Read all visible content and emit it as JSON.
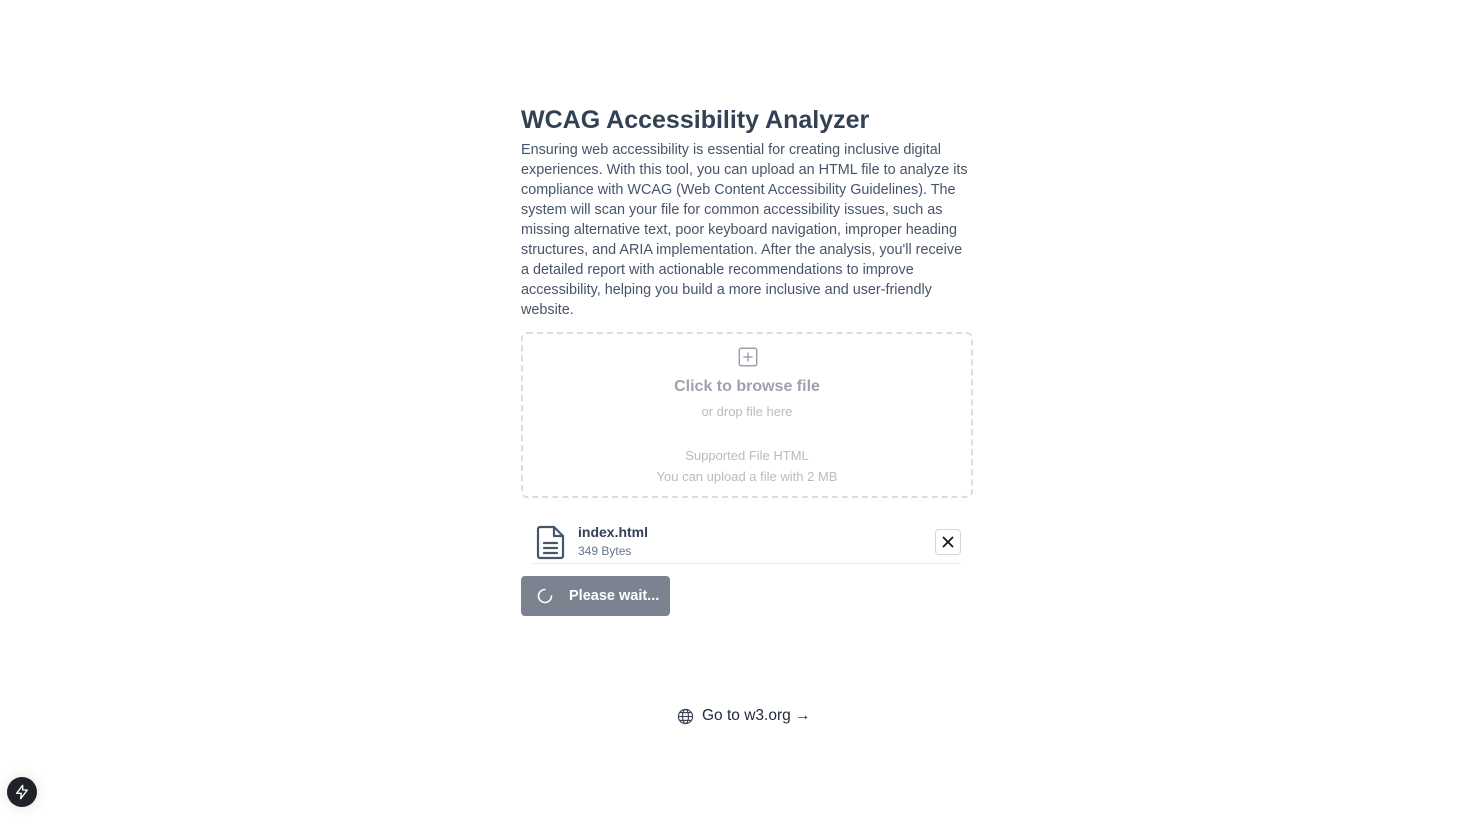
{
  "header": {
    "title": "WCAG Accessibility Analyzer",
    "description": "Ensuring web accessibility is essential for creating inclusive digital experiences. With this tool, you can upload an HTML file to analyze its compliance with WCAG (Web Content Accessibility Guidelines). The system will scan your file for common accessibility issues, such as missing alternative text, poor keyboard navigation, improper heading structures, and ARIA implementation. After the analysis, you'll receive a detailed report with actionable recommendations to improve accessibility, helping you build a more inclusive and user-friendly website."
  },
  "dropzone": {
    "icon": "plus-square-icon",
    "title": "Click to browse file",
    "subtitle": "or drop file here",
    "supported": "Supported File HTML",
    "limit": "You can upload a file with 2 MB"
  },
  "file": {
    "icon": "file-text-icon",
    "name": "index.html",
    "size": "349 Bytes",
    "remove_icon": "close-icon"
  },
  "submit": {
    "icon": "spinner-icon",
    "label": "Please wait..."
  },
  "footer": {
    "icon": "globe-icon",
    "link_label": "Go to w3.org →"
  },
  "fab": {
    "icon": "lightning-icon"
  },
  "colors": {
    "text": "#334155",
    "muted": "#9ca3af",
    "button_disabled": "#7b8390",
    "fab_bg": "#1f2328"
  }
}
